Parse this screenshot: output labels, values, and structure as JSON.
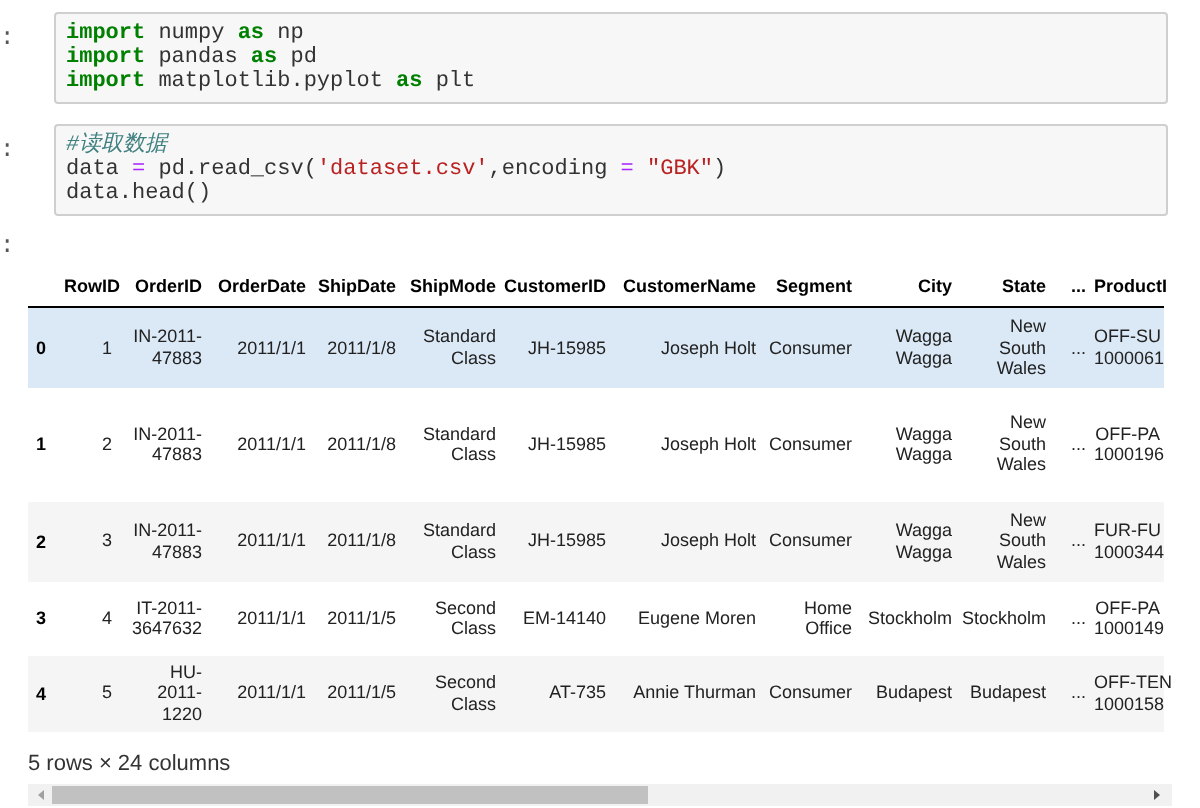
{
  "code_cells": [
    {
      "prompt": ":",
      "lines": [
        [
          {
            "kind": "keyword",
            "text": "import"
          },
          {
            "kind": "plain",
            "text": " numpy "
          },
          {
            "kind": "keyword",
            "text": "as"
          },
          {
            "kind": "plain",
            "text": " np"
          }
        ],
        [
          {
            "kind": "keyword",
            "text": "import"
          },
          {
            "kind": "plain",
            "text": " pandas "
          },
          {
            "kind": "keyword",
            "text": "as"
          },
          {
            "kind": "plain",
            "text": " pd"
          }
        ],
        [
          {
            "kind": "keyword",
            "text": "import"
          },
          {
            "kind": "plain",
            "text": " matplotlib.pyplot "
          },
          {
            "kind": "keyword",
            "text": "as"
          },
          {
            "kind": "plain",
            "text": " plt"
          }
        ]
      ]
    },
    {
      "prompt": ":",
      "lines": [
        [
          {
            "kind": "comment",
            "text": "#读取数据"
          }
        ],
        [
          {
            "kind": "plain",
            "text": "data "
          },
          {
            "kind": "operator",
            "text": "="
          },
          {
            "kind": "plain",
            "text": " pd.read_csv("
          },
          {
            "kind": "string",
            "text": "'dataset.csv'"
          },
          {
            "kind": "plain",
            "text": ",encoding "
          },
          {
            "kind": "operator",
            "text": "="
          },
          {
            "kind": "string",
            "text": " \"GBK\""
          },
          {
            "kind": "plain",
            "text": ")"
          }
        ],
        [
          {
            "kind": "plain",
            "text": "data.head()"
          }
        ]
      ]
    }
  ],
  "output": {
    "prompt": ":",
    "table": {
      "columns": [
        "RowID",
        "OrderID",
        "OrderDate",
        "ShipDate",
        "ShipMode",
        "CustomerID",
        "CustomerName",
        "Segment",
        "City",
        "State",
        "...",
        "ProductI"
      ],
      "rows": [
        {
          "index": "0",
          "highlighted": true,
          "cells": [
            "1",
            "IN-2011-\n47883",
            "2011/1/1",
            "2011/1/8",
            "Standard\nClass",
            "JH-15985",
            "Joseph Holt",
            "Consumer",
            "Wagga\nWagga",
            "New\nSouth\nWales",
            "...",
            "OFF-SU\n1000061"
          ]
        },
        {
          "index": "1",
          "highlighted": false,
          "cells": [
            "2",
            "IN-2011-\n47883",
            "2011/1/1",
            "2011/1/8",
            "Standard\nClass",
            "JH-15985",
            "Joseph Holt",
            "Consumer",
            "Wagga\nWagga",
            "New\nSouth\nWales",
            "...",
            "OFF-PA\n1000196"
          ]
        },
        {
          "index": "2",
          "highlighted": false,
          "cells": [
            "3",
            "IN-2011-\n47883",
            "2011/1/1",
            "2011/1/8",
            "Standard\nClass",
            "JH-15985",
            "Joseph Holt",
            "Consumer",
            "Wagga\nWagga",
            "New\nSouth\nWales",
            "...",
            "FUR-FU\n1000344"
          ]
        },
        {
          "index": "3",
          "highlighted": false,
          "cells": [
            "4",
            "IT-2011-\n3647632",
            "2011/1/1",
            "2011/1/5",
            "Second\nClass",
            "EM-14140",
            "Eugene Moren",
            "Home\nOffice",
            "Stockholm",
            "Stockholm",
            "...",
            "OFF-PA\n1000149"
          ]
        },
        {
          "index": "4",
          "highlighted": false,
          "cells": [
            "5",
            "HU-\n2011-\n1220",
            "2011/1/1",
            "2011/1/5",
            "Second\nClass",
            "AT-735",
            "Annie Thurman",
            "Consumer",
            "Budapest",
            "Budapest",
            "...",
            "OFF-TEN\n1000158"
          ]
        }
      ]
    },
    "summary": "5 rows × 24 columns"
  }
}
